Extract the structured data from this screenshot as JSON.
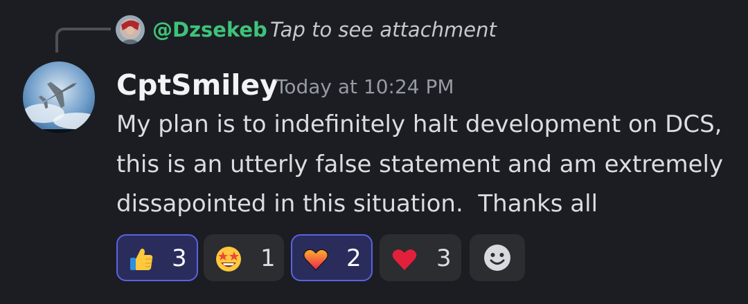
{
  "reply": {
    "username": "@Dzsekeb",
    "preview": "Tap to see attachment",
    "avatar_icon": "user-avatar-icon"
  },
  "message": {
    "author": "CptSmiley",
    "timestamp": "Today at 10:24 PM",
    "avatar_icon": "fighter-jet-avatar-icon",
    "lines": [
      "My plan is to indefinitely halt development on DCS,",
      "this is an utterly false statement and am extremely",
      "dissapointed in this situation.  Thanks all"
    ]
  },
  "reactions": [
    {
      "emoji": "thumbs-up-icon",
      "count": "3",
      "active": true
    },
    {
      "emoji": "star-struck-icon",
      "count": "1",
      "active": false
    },
    {
      "emoji": "heart-on-fire-icon",
      "count": "2",
      "active": true
    },
    {
      "emoji": "red-heart-icon",
      "count": "3",
      "active": false
    }
  ],
  "add_reaction_icon": "add-reaction-smiley-icon",
  "colors": {
    "background": "#1c1d22",
    "reply_username": "#3ec37a",
    "active_reaction_border": "#5b63e0",
    "active_reaction_bg": "#2a2d5c",
    "reaction_bg": "#2b2d31"
  }
}
